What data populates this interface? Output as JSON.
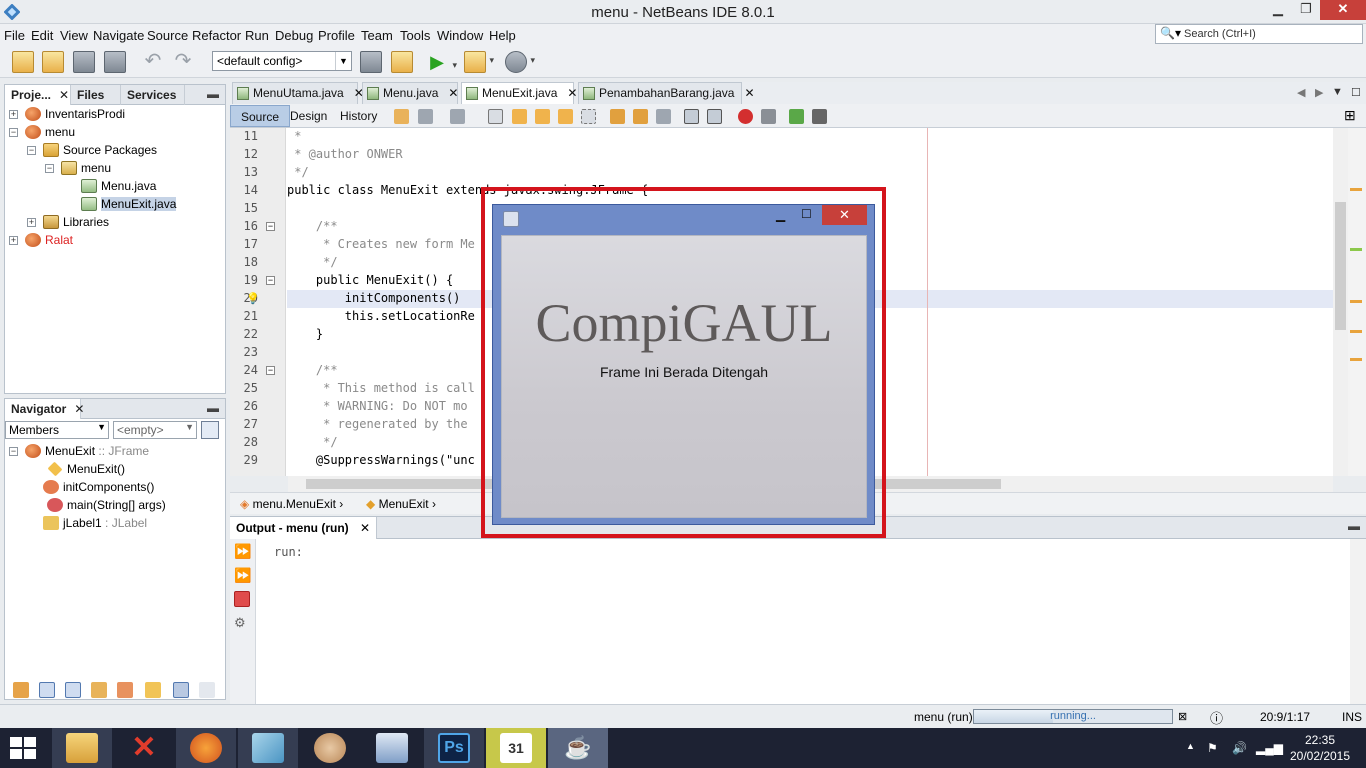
{
  "window": {
    "title": "menu - NetBeans IDE 8.0.1"
  },
  "menubar": [
    "File",
    "Edit",
    "View",
    "Navigate",
    "Source",
    "Refactor",
    "Run",
    "Debug",
    "Profile",
    "Team",
    "Tools",
    "Window",
    "Help"
  ],
  "search": {
    "placeholder": "Search (Ctrl+I)"
  },
  "toolbar": {
    "config": "<default config>"
  },
  "projects_panel": {
    "tabs": [
      "Proje...",
      "Files",
      "Services"
    ],
    "tree": [
      "InventarisProdi",
      "menu",
      "Source Packages",
      "menu",
      "Menu.java",
      "MenuExit.java",
      "Libraries",
      "Ralat"
    ]
  },
  "navigator": {
    "title": "Navigator",
    "filter": "Members",
    "scope": "<empty>",
    "root": "MenuExit",
    "root_type": ":: JFrame",
    "members": [
      {
        "name": "MenuExit()",
        "type": ""
      },
      {
        "name": "initComponents()",
        "type": ""
      },
      {
        "name": "main(String[] args)",
        "type": ""
      },
      {
        "name": "jLabel1",
        "type": ": JLabel"
      }
    ]
  },
  "editor": {
    "tabs": [
      "MenuUtama.java",
      "Menu.java",
      "MenuExit.java",
      "PenambahanBarang.java"
    ],
    "active_tab": "MenuExit.java",
    "modes": [
      "Source",
      "Design",
      "History"
    ],
    "lines": [
      {
        "n": "11",
        "text": " *"
      },
      {
        "n": "12",
        "text": " * @author ONWER"
      },
      {
        "n": "13",
        "text": " */"
      },
      {
        "n": "14",
        "text": "public class MenuExit extends javax.swing.JFrame {"
      },
      {
        "n": "15",
        "text": ""
      },
      {
        "n": "16",
        "text": "    /**"
      },
      {
        "n": "17",
        "text": "     * Creates new form Me"
      },
      {
        "n": "18",
        "text": "     */"
      },
      {
        "n": "19",
        "text": "    public MenuExit() {"
      },
      {
        "n": "20",
        "text": "        initComponents()"
      },
      {
        "n": "21",
        "text": "        this.setLocationRe"
      },
      {
        "n": "22",
        "text": "    }"
      },
      {
        "n": "23",
        "text": ""
      },
      {
        "n": "24",
        "text": "    /**"
      },
      {
        "n": "25",
        "text": "     * This method is call                                         e form."
      },
      {
        "n": "26",
        "text": "     * WARNING: Do NOT mo                                         ways"
      },
      {
        "n": "27",
        "text": "     * regenerated by the"
      },
      {
        "n": "28",
        "text": "     */"
      },
      {
        "n": "29",
        "text": "    @SuppressWarnings(\"unc"
      }
    ],
    "breadcrumbs": [
      "menu.MenuExit",
      "MenuExit"
    ]
  },
  "output": {
    "tab": "Output - menu (run)",
    "text": "run:"
  },
  "status": {
    "project": "menu (run)",
    "progress_text": "running...",
    "progress": 0.4,
    "position": "20:9/1:17",
    "mode": "INS"
  },
  "app_frame": {
    "heading": "CompiGAUL",
    "label": "Frame Ini Berada Ditengah"
  },
  "taskbar": {
    "time": "22:35",
    "date": "20/02/2015"
  }
}
